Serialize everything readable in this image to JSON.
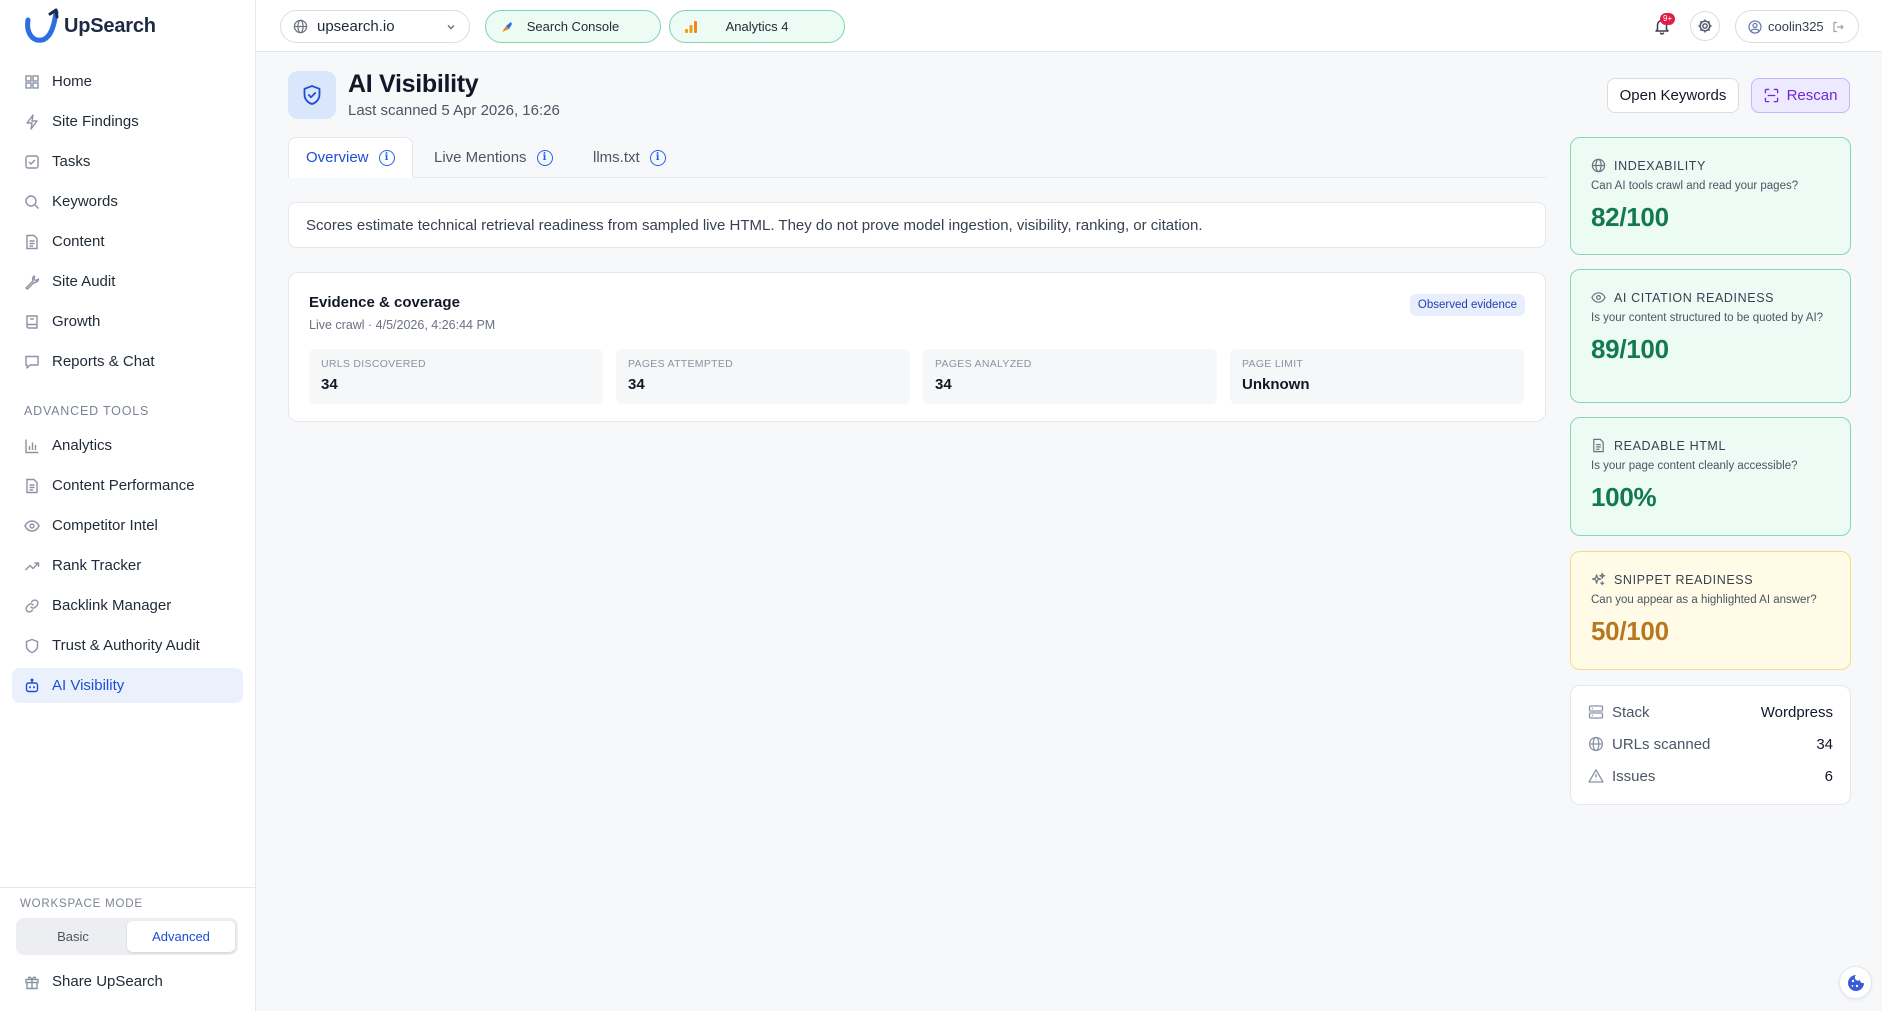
{
  "app": {
    "name": "UpSearch"
  },
  "sidebar": {
    "items": [
      {
        "label": "Home",
        "icon": "home-icon"
      },
      {
        "label": "Site Findings",
        "icon": "bolt-icon"
      },
      {
        "label": "Tasks",
        "icon": "checkbox-icon"
      },
      {
        "label": "Keywords",
        "icon": "search-icon"
      },
      {
        "label": "Content",
        "icon": "document-icon"
      },
      {
        "label": "Site Audit",
        "icon": "wrench-icon"
      },
      {
        "label": "Growth",
        "icon": "book-icon"
      },
      {
        "label": "Reports & Chat",
        "icon": "chat-icon"
      }
    ],
    "advanced_title": "ADVANCED TOOLS",
    "advanced_items": [
      {
        "label": "Analytics",
        "icon": "bar-chart-icon"
      },
      {
        "label": "Content Performance",
        "icon": "document-icon"
      },
      {
        "label": "Competitor Intel",
        "icon": "eye-icon"
      },
      {
        "label": "Rank Tracker",
        "icon": "trending-up-icon"
      },
      {
        "label": "Backlink Manager",
        "icon": "link-icon"
      },
      {
        "label": "Trust & Authority Audit",
        "icon": "shield-icon"
      },
      {
        "label": "AI Visibility",
        "icon": "robot-icon",
        "active": true
      }
    ],
    "workspace_mode": {
      "title": "WORKSPACE MODE",
      "options": [
        "Basic",
        "Advanced"
      ],
      "selected": "Advanced"
    },
    "share_label": "Share UpSearch"
  },
  "topbar": {
    "site": "upsearch.io",
    "search_console": "Search Console",
    "analytics": "Analytics 4",
    "notifications_badge": "9+",
    "username": "coolin325"
  },
  "header": {
    "title": "AI Visibility",
    "last_scanned": "Last scanned 5 Apr 2026, 16:26",
    "open_keywords": "Open Keywords",
    "rescan": "Rescan"
  },
  "tabs": [
    {
      "label": "Overview",
      "active": true
    },
    {
      "label": "Live Mentions"
    },
    {
      "label": "llms.txt"
    }
  ],
  "notice": "Scores estimate technical retrieval readiness from sampled live HTML. They do not prove model ingestion, visibility, ranking, or citation.",
  "evidence": {
    "title": "Evidence & coverage",
    "subtitle": "Live crawl · 4/5/2026, 4:26:44 PM",
    "badge": "Observed evidence",
    "stats": [
      {
        "label": "URLS DISCOVERED",
        "value": "34"
      },
      {
        "label": "PAGES ATTEMPTED",
        "value": "34"
      },
      {
        "label": "PAGES ANALYZED",
        "value": "34"
      },
      {
        "label": "PAGE LIMIT",
        "value": "Unknown"
      }
    ]
  },
  "scores": [
    {
      "title": "INDEXABILITY",
      "question": "Can AI tools crawl and read your pages?",
      "value": "82/100",
      "tone": "green",
      "icon": "globe-icon"
    },
    {
      "title": "AI CITATION READINESS",
      "question": "Is your content structured to be quoted by AI?",
      "value": "89/100",
      "tone": "green",
      "icon": "eye-icon"
    },
    {
      "title": "READABLE HTML",
      "question": "Is your page content cleanly accessible?",
      "value": "100%",
      "tone": "green",
      "icon": "document-icon"
    },
    {
      "title": "SNIPPET READINESS",
      "question": "Can you appear as a highlighted AI answer?",
      "value": "50/100",
      "tone": "yellow",
      "icon": "sparkle-icon"
    }
  ],
  "meta": [
    {
      "label": "Stack",
      "value": "Wordpress",
      "icon": "server-icon"
    },
    {
      "label": "URLs scanned",
      "value": "34",
      "icon": "globe-icon"
    },
    {
      "label": "Issues",
      "value": "6",
      "icon": "warning-icon"
    }
  ],
  "colors": {
    "accent": "#1d4ed8",
    "green_score": "#137a4f",
    "yellow_score": "#b7791f",
    "rescan": "#6d28d9"
  }
}
